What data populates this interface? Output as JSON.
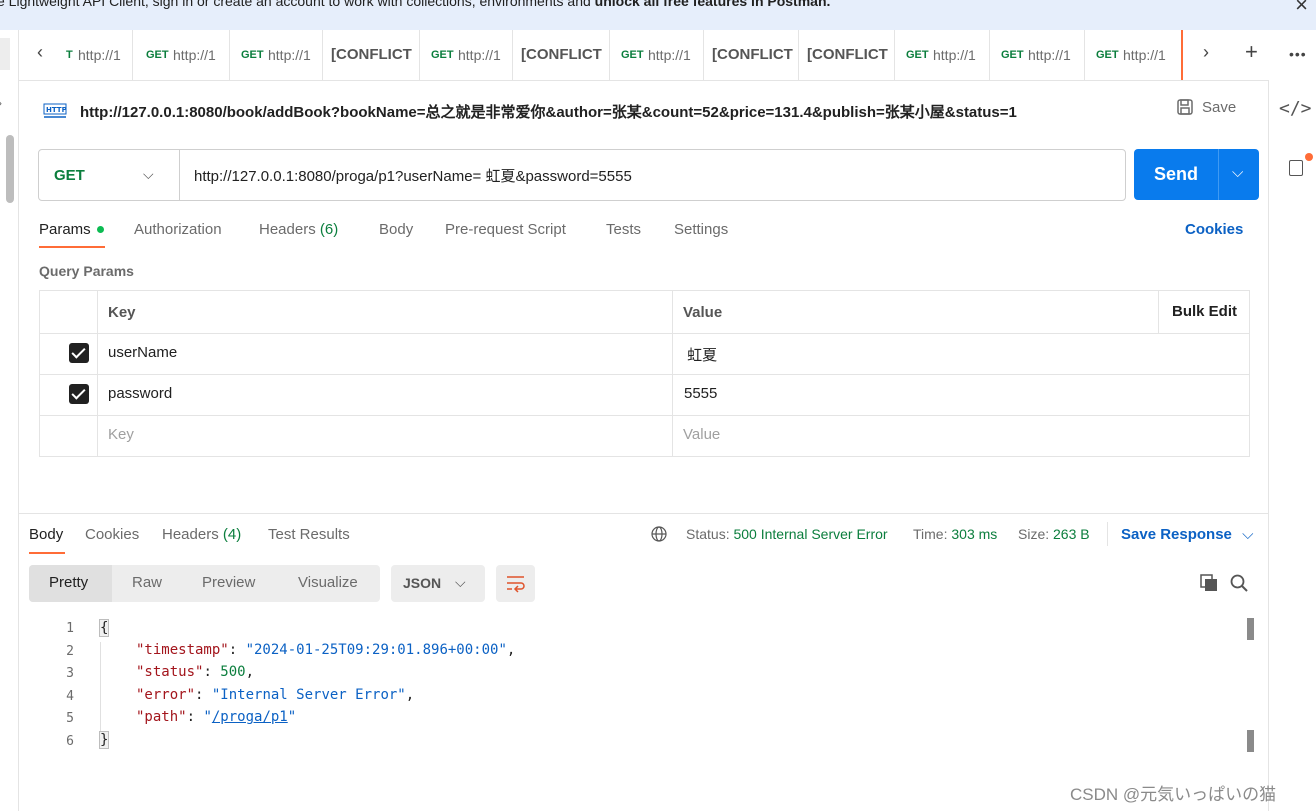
{
  "banner": {
    "text": "e Lightweight API Client, sign in or create an account to work with collections, environments and ",
    "bold": "unlock all free features in Postman."
  },
  "tabs": [
    {
      "method": "",
      "label": "http://1",
      "partialMethod": "T"
    },
    {
      "method": "GET",
      "label": "http://1"
    },
    {
      "method": "GET",
      "label": "http://1"
    },
    {
      "conflict": "[CONFLICT"
    },
    {
      "method": "GET",
      "label": "http://1"
    },
    {
      "conflict": "[CONFLICT"
    },
    {
      "method": "GET",
      "label": "http://1"
    },
    {
      "conflict": "[CONFLICT"
    },
    {
      "conflict": "[CONFLICT"
    },
    {
      "method": "GET",
      "label": "http://1"
    },
    {
      "method": "GET",
      "label": "http://1"
    },
    {
      "method": "GET",
      "label": "http://1"
    }
  ],
  "request": {
    "title": "http://127.0.0.1:8080/book/addBook?bookName=总之就是非常爱你&author=张某&count=52&price=131.4&publish=张某小屋&status=1",
    "save_label": "Save",
    "method": "GET",
    "url": "http://127.0.0.1:8080/proga/p1?userName= 虹夏&password=5555",
    "send_label": "Send"
  },
  "req_tabs": {
    "params": "Params",
    "authorization": "Authorization",
    "headers": "Headers",
    "headers_count": "(6)",
    "body": "Body",
    "prerequest": "Pre-request Script",
    "tests": "Tests",
    "settings": "Settings",
    "cookies": "Cookies"
  },
  "query_params": {
    "title": "Query Params",
    "col_key": "Key",
    "col_value": "Value",
    "bulk_edit": "Bulk Edit",
    "rows": [
      {
        "key": "userName",
        "value": " 虹夏",
        "checked": true
      },
      {
        "key": "password",
        "value": "5555",
        "checked": true
      }
    ],
    "placeholder_key": "Key",
    "placeholder_value": "Value"
  },
  "response": {
    "tabs": {
      "body": "Body",
      "cookies": "Cookies",
      "headers": "Headers",
      "headers_count": "(4)",
      "tests": "Test Results"
    },
    "status_label": "Status:",
    "status_value": "500 Internal Server Error",
    "time_label": "Time:",
    "time_value": "303 ms",
    "size_label": "Size:",
    "size_value": "263 B",
    "save_response": "Save Response",
    "views": [
      "Pretty",
      "Raw",
      "Preview",
      "Visualize"
    ],
    "format": "JSON",
    "line_numbers": [
      "1",
      "2",
      "3",
      "4",
      "5",
      "6"
    ],
    "json": {
      "open": "{",
      "close": "}",
      "k_timestamp": "\"timestamp\"",
      "v_timestamp": "\"2024-01-25T09:29:01.896+00:00\"",
      "k_status": "\"status\"",
      "v_status": "500",
      "k_error": "\"error\"",
      "v_error": "\"Internal Server Error\"",
      "k_path": "\"path\"",
      "v_path": "/proga/p1"
    }
  },
  "watermark": "CSDN @元気いっぱいの猫",
  "colors": {
    "accent": "#ff6c37",
    "send": "#097bed",
    "method_get": "#0b7e3d",
    "link": "#0b61c4"
  }
}
